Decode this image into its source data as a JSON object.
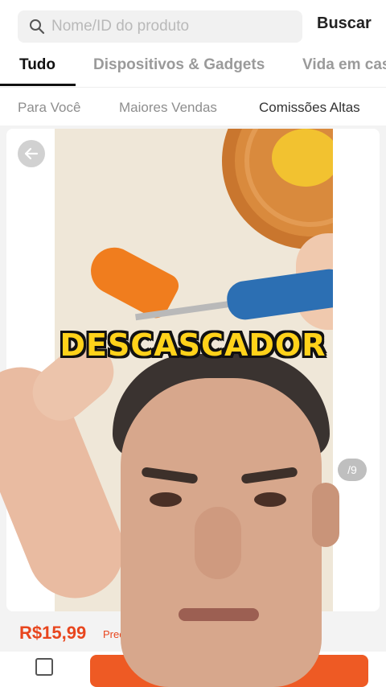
{
  "search": {
    "placeholder": "Nome/ID do produto",
    "button_label": "Buscar",
    "icon": "search-icon"
  },
  "tabs": [
    {
      "label": "Tudo",
      "active": true
    },
    {
      "label": "Dispositivos & Gadgets",
      "active": false
    },
    {
      "label": "Vida em cas",
      "active": false
    }
  ],
  "subtabs": [
    {
      "label": "Para Você",
      "active": false
    },
    {
      "label": "Maiores Vendas",
      "active": false
    },
    {
      "label": "Comissões Altas",
      "active": true
    }
  ],
  "product": {
    "image_counter": "/9",
    "price": "R$15,99",
    "price_note": "Prec"
  },
  "overlay": {
    "caption": "DESCASCADOR"
  },
  "colors": {
    "accent": "#ee5a24",
    "price": "#e8461e",
    "caption": "#ffd21a"
  }
}
